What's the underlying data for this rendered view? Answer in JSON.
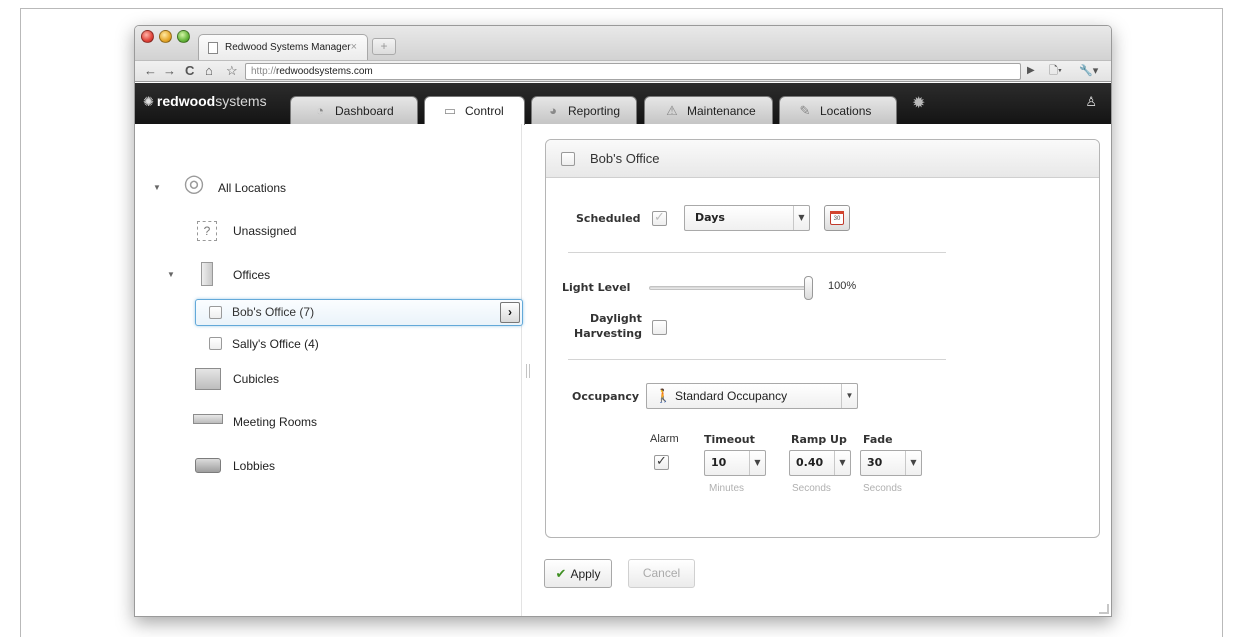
{
  "browser": {
    "tab_title": "Redwood Systems Manager",
    "tab_close": "×",
    "url_protocol": "http://",
    "url_host": "redwoodsystems.com",
    "nav": {
      "back": "←",
      "forward": "→",
      "reload": "C",
      "home": "⌂",
      "star": "☆",
      "go": "▶",
      "page_menu": "🗋▾",
      "wrench_menu": "🔧▾"
    }
  },
  "app": {
    "logo_bold": "redwood",
    "logo_light": "systems",
    "logo_icon": "sun-icon",
    "tabs": [
      {
        "label": "Dashboard",
        "icon": "gauge-icon"
      },
      {
        "label": "Control",
        "icon": "switch-icon"
      },
      {
        "label": "Reporting",
        "icon": "pie-icon"
      },
      {
        "label": "Maintenance",
        "icon": "warning-icon"
      },
      {
        "label": "Locations",
        "icon": "pencil-icon"
      }
    ],
    "active_tab": "Control"
  },
  "tree": {
    "items": [
      {
        "label": "All Locations",
        "icon": "globe-icon",
        "expanded": true
      },
      {
        "label": "Unassigned",
        "icon": "question-icon"
      },
      {
        "label": "Offices",
        "icon": "door-icon",
        "expanded": true
      },
      {
        "label": "Bob's Office  (7)",
        "checkbox": true,
        "selected": true
      },
      {
        "label": "Sally's Office  (4)",
        "checkbox": true
      },
      {
        "label": "Cubicles",
        "icon": "cubicle-icon"
      },
      {
        "label": "Meeting Rooms",
        "icon": "meeting-table-icon"
      },
      {
        "label": "Lobbies",
        "icon": "sofa-icon"
      }
    ]
  },
  "panel": {
    "title": "Bob's Office",
    "scheduled_label": "Scheduled",
    "scheduled_checked": true,
    "schedule_select": "Days",
    "light_level_label": "Light Level",
    "light_level_value": "100%",
    "light_level_fraction": 1.0,
    "daylight_label_1": "Daylight",
    "daylight_label_2": "Harvesting",
    "daylight_checked": false,
    "occupancy_label": "Occupancy",
    "occupancy_select": "Standard Occupancy",
    "alarm_label": "Alarm",
    "alarm_checked": true,
    "timeout_label": "Timeout",
    "timeout_value": "10",
    "timeout_unit": "Minutes",
    "rampup_label": "Ramp Up",
    "rampup_value": "0.40",
    "rampup_unit": "Seconds",
    "fade_label": "Fade",
    "fade_value": "30",
    "fade_unit": "Seconds"
  },
  "actions": {
    "apply": "Apply",
    "cancel": "Cancel"
  },
  "colors": {
    "selection_border": "#63a9d9",
    "apply_check": "#3f8f22",
    "appbar": "#1c1c1c"
  }
}
